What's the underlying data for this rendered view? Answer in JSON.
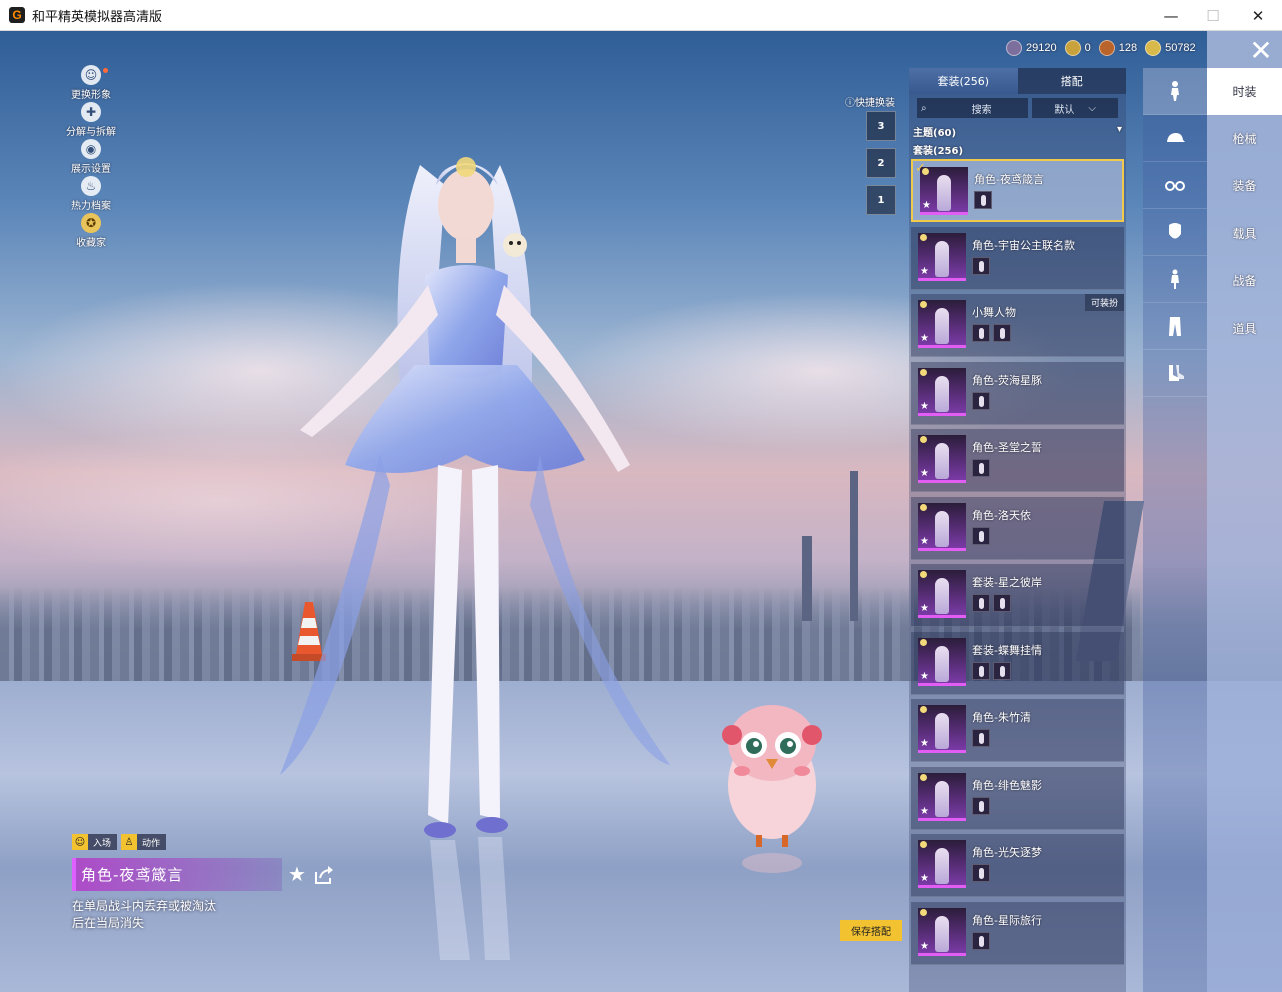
{
  "window": {
    "title": "和平精英模拟器高清版",
    "logo_letter": "G",
    "minimize": "—",
    "maximize": "☐",
    "close": "✕"
  },
  "left_menu": [
    {
      "label": "更换形象",
      "icon": "user-icon",
      "glyph": "☺"
    },
    {
      "label": "分解与拆解",
      "icon": "puzzle-icon",
      "glyph": "✚"
    },
    {
      "label": "展示设置",
      "icon": "eye-icon",
      "glyph": "◉"
    },
    {
      "label": "热力档案",
      "icon": "flame-icon",
      "glyph": "♨"
    },
    {
      "label": "收藏家",
      "icon": "badge-icon",
      "glyph": "✪"
    }
  ],
  "quick_change": {
    "label": "快捷换装",
    "slots": [
      "3",
      "2",
      "1"
    ]
  },
  "currencies": [
    {
      "name": "currency-1",
      "value": "29120",
      "color": "#7c6f9e"
    },
    {
      "name": "currency-2",
      "value": "0",
      "color": "#c9a23c"
    },
    {
      "name": "currency-3",
      "value": "128",
      "color": "#b9642a"
    },
    {
      "name": "currency-4",
      "value": "50782",
      "color": "#d8b94a"
    }
  ],
  "panel": {
    "tab_outfits": "套装(256)",
    "tab_match": "搭配",
    "search_placeholder": "搜索",
    "sort_label": "默认",
    "theme_label": "主题(60)",
    "set_label": "套装(256)",
    "wearable_tag": "可装扮"
  },
  "items": [
    {
      "name": "角色-夜鸢箴言",
      "selected": true,
      "subs": 1
    },
    {
      "name": "角色-宇宙公主联名款",
      "selected": false,
      "subs": 1
    },
    {
      "name": "小舞人物",
      "selected": false,
      "subs": 2,
      "wearable": true
    },
    {
      "name": "角色-荧海星豚",
      "selected": false,
      "subs": 1
    },
    {
      "name": "角色-圣堂之誓",
      "selected": false,
      "subs": 1
    },
    {
      "name": "角色-洛天依",
      "selected": false,
      "subs": 1
    },
    {
      "name": "套装-星之彼岸",
      "selected": false,
      "subs": 2
    },
    {
      "name": "套装-蝶舞挂情",
      "selected": false,
      "subs": 2
    },
    {
      "name": "角色-朱竹清",
      "selected": false,
      "subs": 1
    },
    {
      "name": "角色-绯色魅影",
      "selected": false,
      "subs": 1
    },
    {
      "name": "角色-光矢逐梦",
      "selected": false,
      "subs": 1
    },
    {
      "name": "角色-星际旅行",
      "selected": false,
      "subs": 1
    }
  ],
  "categories": [
    "character-icon",
    "hat-icon",
    "glasses-icon",
    "mask-icon",
    "top-icon",
    "pants-icon",
    "shoes-icon"
  ],
  "right_nav": [
    "时装",
    "枪械",
    "装备",
    "载具",
    "战备",
    "道具"
  ],
  "close_button": "✕",
  "selected_info": {
    "tag_entry": "入场",
    "tag_action": "动作",
    "name": "角色-夜鸢箴言",
    "desc": "在单局战斗内丢弃或被淘汰后在当局消失",
    "fav_glyph": "★"
  },
  "save_button": "保存搭配"
}
